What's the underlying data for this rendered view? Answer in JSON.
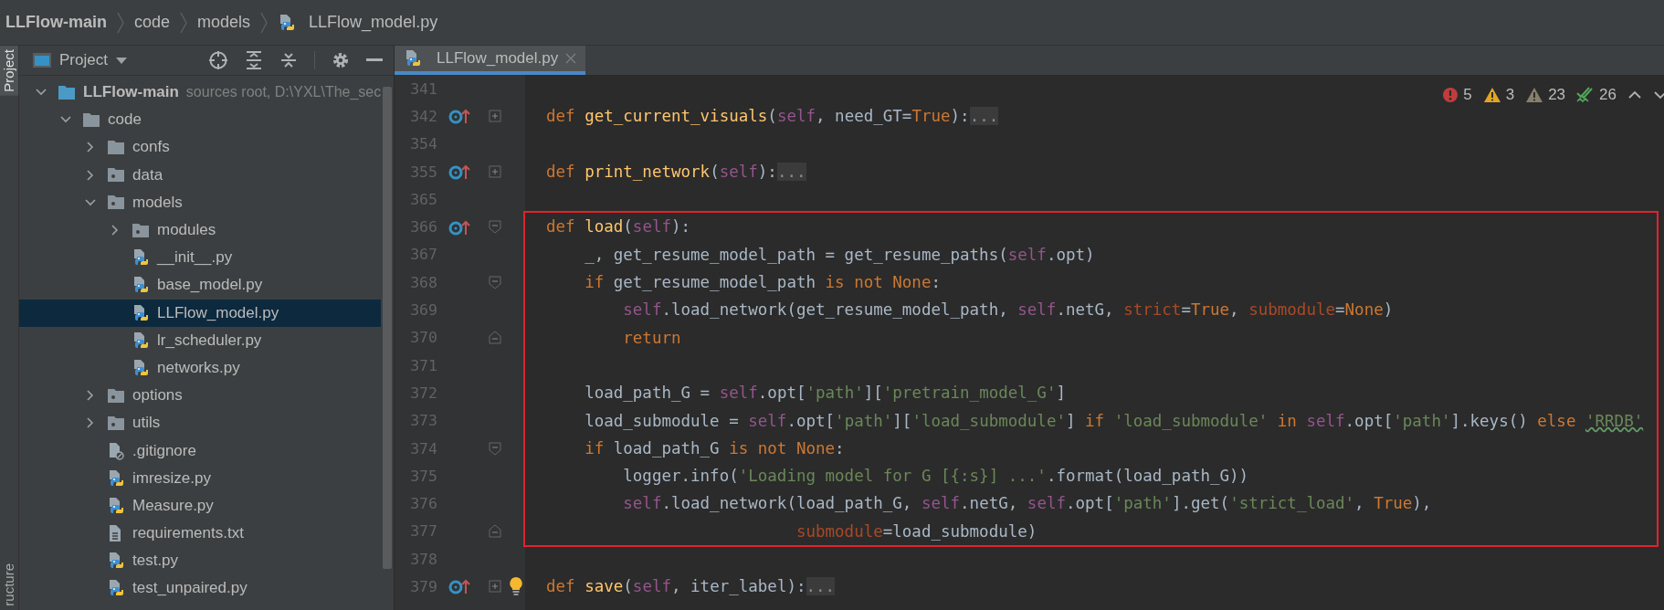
{
  "breadcrumbs": [
    {
      "label": "LLFlow-main",
      "kind": "root"
    },
    {
      "label": "code",
      "kind": "folder"
    },
    {
      "label": "models",
      "kind": "folder"
    },
    {
      "label": "LLFlow_model.py",
      "kind": "python"
    }
  ],
  "tool_windows": [
    {
      "label": "Project",
      "selected": true
    },
    {
      "label": "ructure",
      "selected": false
    }
  ],
  "project_panel": {
    "title": "Project",
    "tree": [
      {
        "label": "LLFlow-main",
        "detail": "sources root,  D:\\YXL\\The_sec",
        "kind": "source-root",
        "expanded": true,
        "selected": false,
        "children": [
          {
            "label": "code",
            "kind": "folder",
            "expanded": true,
            "selected": false,
            "children": [
              {
                "label": "confs",
                "kind": "folder",
                "expanded": false,
                "selected": false
              },
              {
                "label": "data",
                "kind": "package",
                "expanded": false,
                "selected": false
              },
              {
                "label": "models",
                "kind": "package",
                "expanded": true,
                "selected": false,
                "children": [
                  {
                    "label": "modules",
                    "kind": "package",
                    "expanded": false,
                    "selected": false
                  },
                  {
                    "label": "__init__.py",
                    "kind": "python",
                    "selected": false
                  },
                  {
                    "label": "base_model.py",
                    "kind": "python",
                    "selected": false
                  },
                  {
                    "label": "LLFlow_model.py",
                    "kind": "python",
                    "selected": true
                  },
                  {
                    "label": "lr_scheduler.py",
                    "kind": "python",
                    "selected": false
                  },
                  {
                    "label": "networks.py",
                    "kind": "python",
                    "selected": false
                  }
                ]
              },
              {
                "label": "options",
                "kind": "package",
                "expanded": false,
                "selected": false
              },
              {
                "label": "utils",
                "kind": "package",
                "expanded": false,
                "selected": false
              },
              {
                "label": ".gitignore",
                "kind": "ignore",
                "selected": false
              },
              {
                "label": "imresize.py",
                "kind": "python",
                "selected": false
              },
              {
                "label": "Measure.py",
                "kind": "python",
                "selected": false
              },
              {
                "label": "requirements.txt",
                "kind": "text",
                "selected": false
              },
              {
                "label": "test.py",
                "kind": "python",
                "selected": false
              },
              {
                "label": "test_unpaired.py",
                "kind": "python",
                "selected": false
              }
            ]
          }
        ]
      }
    ]
  },
  "editor": {
    "tabs": [
      {
        "label": "LLFlow_model.py",
        "selected": true
      }
    ],
    "inspections": [
      {
        "kind": "error",
        "count": "5"
      },
      {
        "kind": "warning",
        "count": "3"
      },
      {
        "kind": "weak",
        "count": "23"
      },
      {
        "kind": "typo",
        "count": "26"
      }
    ],
    "blocks": [
      {
        "framed": false,
        "lines": [
          {
            "number": "341",
            "overrides": false,
            "bulb": false
          },
          {
            "number": "342",
            "overrides": true,
            "bulb": false,
            "fold": {
              "kind": "expand"
            },
            "tokens": [
              {
                "kind": "kw",
                "text": "def "
              },
              {
                "kind": "fn",
                "text": "get_current_visuals"
              },
              {
                "kind": "plain",
                "text": "("
              },
              {
                "kind": "self",
                "text": "self"
              },
              {
                "kind": "plain",
                "text": ", need_GT="
              },
              {
                "kind": "kw",
                "text": "True"
              },
              {
                "kind": "plain",
                "text": "):"
              },
              {
                "kind": "fold",
                "text": "..."
              }
            ]
          },
          {
            "number": "354",
            "overrides": false,
            "bulb": false
          },
          {
            "number": "355",
            "overrides": true,
            "bulb": false,
            "fold": {
              "kind": "expand"
            },
            "tokens": [
              {
                "kind": "kw",
                "text": "def "
              },
              {
                "kind": "fn",
                "text": "print_network"
              },
              {
                "kind": "plain",
                "text": "("
              },
              {
                "kind": "self",
                "text": "self"
              },
              {
                "kind": "plain",
                "text": "):"
              },
              {
                "kind": "fold",
                "text": "..."
              }
            ]
          },
          {
            "number": "365",
            "overrides": false,
            "bulb": false
          }
        ]
      },
      {
        "framed": true,
        "lines": [
          {
            "number": "366",
            "overrides": true,
            "bulb": false,
            "fold": {
              "kind": "open"
            },
            "tokens": [
              {
                "kind": "kw",
                "text": "def "
              },
              {
                "kind": "fn",
                "text": "load"
              },
              {
                "kind": "plain",
                "text": "("
              },
              {
                "kind": "self",
                "text": "self"
              },
              {
                "kind": "plain",
                "text": "):"
              }
            ]
          },
          {
            "number": "367",
            "overrides": false,
            "bulb": false,
            "tokens": [
              {
                "kind": "plain",
                "text": "    _, get_resume_model_path = get_resume_paths("
              },
              {
                "kind": "self",
                "text": "self"
              },
              {
                "kind": "plain",
                "text": ".opt)"
              }
            ]
          },
          {
            "number": "368",
            "overrides": false,
            "bulb": false,
            "fold": {
              "kind": "open"
            },
            "tokens": [
              {
                "kind": "kw",
                "text": "    if"
              },
              {
                "kind": "plain",
                "text": " get_resume_model_path "
              },
              {
                "kind": "kw",
                "text": "is not None"
              },
              {
                "kind": "plain",
                "text": ":"
              }
            ]
          },
          {
            "number": "369",
            "overrides": false,
            "bulb": false,
            "tokens": [
              {
                "kind": "self",
                "text": "        self"
              },
              {
                "kind": "plain",
                "text": ".load_network(get_resume_model_path, "
              },
              {
                "kind": "self",
                "text": "self"
              },
              {
                "kind": "plain",
                "text": ".netG, "
              },
              {
                "kind": "arg",
                "text": "strict"
              },
              {
                "kind": "plain",
                "text": "="
              },
              {
                "kind": "kw",
                "text": "True"
              },
              {
                "kind": "plain",
                "text": ", "
              },
              {
                "kind": "arg",
                "text": "submodule"
              },
              {
                "kind": "plain",
                "text": "="
              },
              {
                "kind": "kw",
                "text": "None"
              },
              {
                "kind": "plain",
                "text": ")"
              }
            ]
          },
          {
            "number": "370",
            "overrides": false,
            "bulb": false,
            "fold": {
              "kind": "close"
            },
            "tokens": [
              {
                "kind": "kw",
                "text": "        return"
              }
            ]
          },
          {
            "number": "371",
            "overrides": false,
            "bulb": false
          },
          {
            "number": "372",
            "overrides": false,
            "bulb": false,
            "tokens": [
              {
                "kind": "plain",
                "text": "    load_path_G = "
              },
              {
                "kind": "self",
                "text": "self"
              },
              {
                "kind": "plain",
                "text": ".opt["
              },
              {
                "kind": "str",
                "text": "'path'"
              },
              {
                "kind": "plain",
                "text": "]["
              },
              {
                "kind": "str",
                "text": "'pretrain_model_G'"
              },
              {
                "kind": "plain",
                "text": "]"
              }
            ]
          },
          {
            "number": "373",
            "overrides": false,
            "bulb": false,
            "tokens": [
              {
                "kind": "plain",
                "text": "    load_submodule = "
              },
              {
                "kind": "self",
                "text": "self"
              },
              {
                "kind": "plain",
                "text": ".opt["
              },
              {
                "kind": "str",
                "text": "'path'"
              },
              {
                "kind": "plain",
                "text": "]["
              },
              {
                "kind": "str",
                "text": "'load_submodule'"
              },
              {
                "kind": "plain",
                "text": "] "
              },
              {
                "kind": "kw",
                "text": "if "
              },
              {
                "kind": "str",
                "text": "'load_submodule' "
              },
              {
                "kind": "kw",
                "text": "in "
              },
              {
                "kind": "self",
                "text": "self"
              },
              {
                "kind": "plain",
                "text": ".opt["
              },
              {
                "kind": "str",
                "text": "'path'"
              },
              {
                "kind": "plain",
                "text": "].keys() "
              },
              {
                "kind": "kw",
                "text": "else "
              },
              {
                "kind": "str-typo",
                "text": "'RRDB'"
              }
            ]
          },
          {
            "number": "374",
            "overrides": false,
            "bulb": false,
            "fold": {
              "kind": "open"
            },
            "tokens": [
              {
                "kind": "kw",
                "text": "    if"
              },
              {
                "kind": "plain",
                "text": " load_path_G "
              },
              {
                "kind": "kw",
                "text": "is not None"
              },
              {
                "kind": "plain",
                "text": ":"
              }
            ]
          },
          {
            "number": "375",
            "overrides": false,
            "bulb": false,
            "tokens": [
              {
                "kind": "plain",
                "text": "        logger.info("
              },
              {
                "kind": "str",
                "text": "'Loading model for G [{:s}] ...'"
              },
              {
                "kind": "plain",
                "text": ".format(load_path_G))"
              }
            ]
          },
          {
            "number": "376",
            "overrides": false,
            "bulb": false,
            "tokens": [
              {
                "kind": "self",
                "text": "        self"
              },
              {
                "kind": "plain",
                "text": ".load_network(load_path_G, "
              },
              {
                "kind": "self",
                "text": "self"
              },
              {
                "kind": "plain",
                "text": ".netG, "
              },
              {
                "kind": "self",
                "text": "self"
              },
              {
                "kind": "plain",
                "text": ".opt["
              },
              {
                "kind": "str",
                "text": "'path'"
              },
              {
                "kind": "plain",
                "text": "].get("
              },
              {
                "kind": "str",
                "text": "'strict_load'"
              },
              {
                "kind": "plain",
                "text": ", "
              },
              {
                "kind": "kw",
                "text": "True"
              },
              {
                "kind": "plain",
                "text": "),"
              }
            ]
          },
          {
            "number": "377",
            "overrides": false,
            "bulb": false,
            "fold": {
              "kind": "close"
            },
            "tokens": [
              {
                "kind": "arg",
                "text": "                          submodule"
              },
              {
                "kind": "plain",
                "text": "=load_submodule)"
              }
            ]
          }
        ]
      },
      {
        "framed": false,
        "lines": [
          {
            "number": "378",
            "overrides": false,
            "bulb": false
          },
          {
            "number": "379",
            "overrides": true,
            "bulb": true,
            "fold": {
              "kind": "expand"
            },
            "tokens": [
              {
                "kind": "kw",
                "text": "def "
              },
              {
                "kind": "fn",
                "text": "save"
              },
              {
                "kind": "plain",
                "text": "("
              },
              {
                "kind": "self",
                "text": "self"
              },
              {
                "kind": "plain",
                "text": ", iter_label):"
              },
              {
                "kind": "fold",
                "text": "..."
              }
            ]
          }
        ]
      }
    ]
  }
}
